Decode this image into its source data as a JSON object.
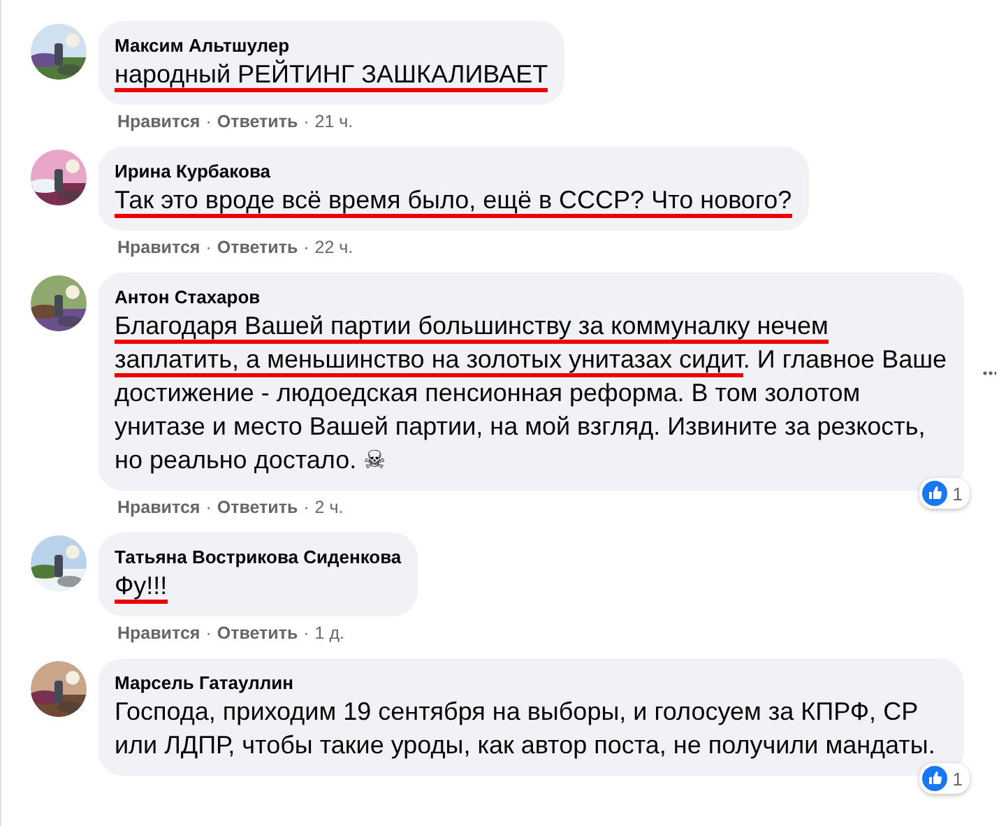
{
  "comments": [
    {
      "author": "Максим Альтшулер",
      "segments": [
        {
          "text": "народный РЕЙТИНГ ЗАШКАЛИВАЕТ",
          "underlined": true
        }
      ],
      "actions": [
        {
          "kind": "link",
          "text": "Нравится"
        },
        {
          "kind": "sep",
          "text": "·"
        },
        {
          "kind": "link",
          "text": "Ответить"
        },
        {
          "kind": "sep",
          "text": "·"
        },
        {
          "kind": "time",
          "text": "21 ч."
        }
      ]
    },
    {
      "author": "Ирина Курбакова",
      "segments": [
        {
          "text": "Так это вроде всё время было, ещё в СССР? Что нового?",
          "underlined": true
        }
      ],
      "actions": [
        {
          "kind": "link",
          "text": "Нравится"
        },
        {
          "kind": "sep",
          "text": "·"
        },
        {
          "kind": "link",
          "text": "Ответить"
        },
        {
          "kind": "sep",
          "text": "·"
        },
        {
          "kind": "time",
          "text": "22 ч."
        }
      ]
    },
    {
      "author": "Антон Стахаров",
      "segments": [
        {
          "text": "Благодаря Вашей партии большинству за коммуналку нечем заплатить, а меньшинство на золотых унитазах сидит",
          "underlined": true
        },
        {
          "text": ". И главное Ваше достижение - людоедская пенсионная реформа. В том золотом унитазе и место Вашей партии, на мой взгляд. Извините за резкость, но реально достало. ☠",
          "underlined": false
        }
      ],
      "reactions": {
        "count": "1"
      },
      "more_menu": true,
      "actions": [
        {
          "kind": "link",
          "text": "Нравится"
        },
        {
          "kind": "sep",
          "text": "·"
        },
        {
          "kind": "link",
          "text": "Ответить"
        },
        {
          "kind": "sep",
          "text": "·"
        },
        {
          "kind": "time",
          "text": "2 ч."
        }
      ]
    },
    {
      "author": "Татьяна Вострикова Сиденкова",
      "segments": [
        {
          "text": "Фу!!!",
          "underlined": true
        }
      ],
      "actions": [
        {
          "kind": "link",
          "text": "Нравится"
        },
        {
          "kind": "sep",
          "text": "·"
        },
        {
          "kind": "link",
          "text": "Ответить"
        },
        {
          "kind": "sep",
          "text": "·"
        },
        {
          "kind": "time",
          "text": "1 д."
        }
      ]
    },
    {
      "author": "Марсель Гатауллин",
      "segments": [
        {
          "text": "Господа, приходим 19 сентября на выборы, и голосуем за КПРФ, СР или ЛДПР, чтобы такие уроды, как автор поста, не получили мандаты.",
          "underlined": false
        }
      ],
      "reactions": {
        "count": "1"
      }
    }
  ]
}
